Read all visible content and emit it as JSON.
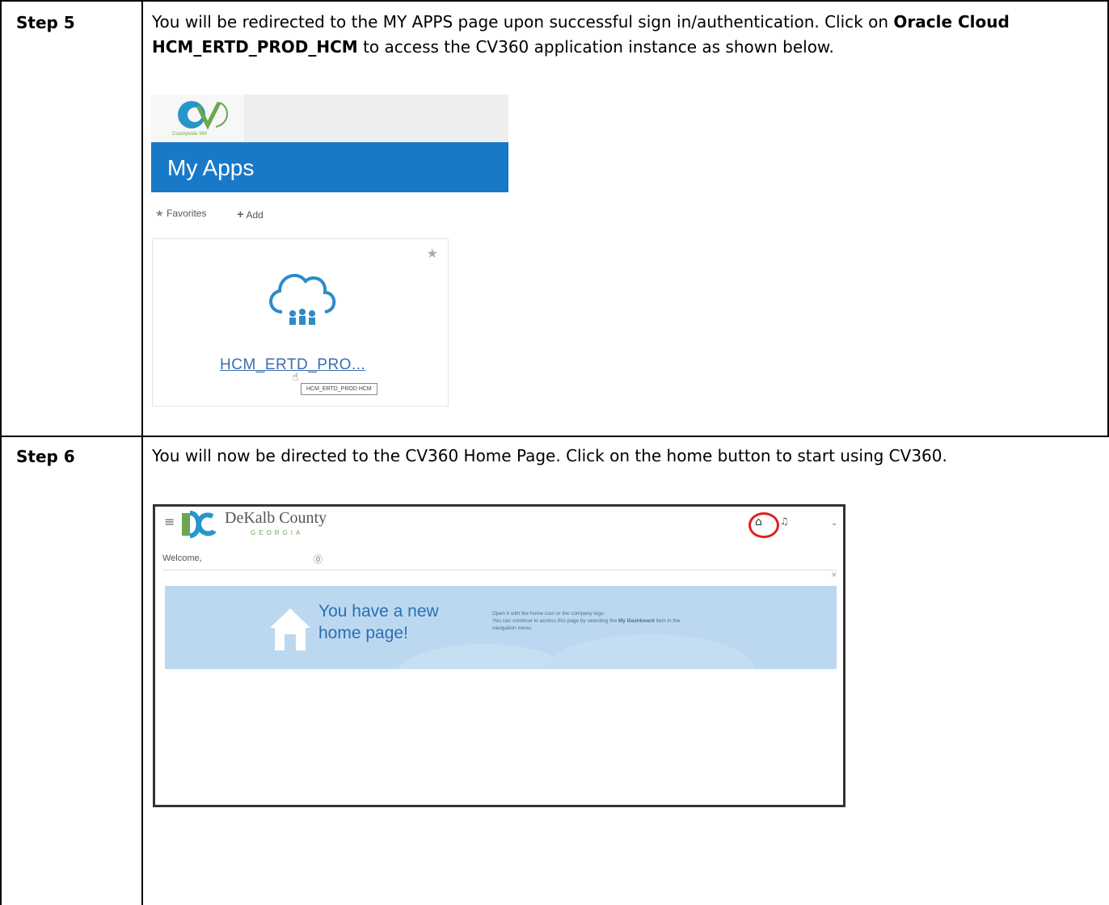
{
  "steps": [
    {
      "label": "Step 5",
      "text_before": "You will be redirected to the MY APPS page upon successful sign in/authentication. Click on",
      "text_bold": "Oracle Cloud HCM_ERTD_PROD_HCM",
      "text_after": "to access the CV360 application instance as shown below."
    },
    {
      "label": "Step 6",
      "text": "You will now be directed to the CV360 Home Page. Click on the home button to start using CV360."
    }
  ],
  "my_apps_screenshot": {
    "logo_subtext": "Countywide 360",
    "title": "My Apps",
    "favorites_label": "Favorites",
    "add_label": "Add",
    "app_tile_label": "HCM_ERTD_PRO...",
    "tooltip": "HCM_ERTD_PROD HCM",
    "icons": [
      "star-icon",
      "plus-icon",
      "cloud-people-icon",
      "cursor-icon"
    ],
    "colors": {
      "header_bar": "#1979c9",
      "link": "#3a6db0"
    }
  },
  "cv360_screenshot": {
    "brand": "DeKalb County",
    "brand_sub": "GEORGIA",
    "welcome": "Welcome,",
    "banner_title": "You have a new home page!",
    "banner_title_line1": "You have a new",
    "banner_title_line2": "home page!",
    "banner_text_line1": "Open it with the home icon or the company logo.",
    "banner_text_line2": "You can continue to access this page by selecting the",
    "banner_text_bold": "My Dashboard",
    "banner_text_line3": "item in the navigation menu.",
    "icons": [
      "menu-icon",
      "home-icon",
      "bell-icon",
      "chevron-down-icon",
      "help-icon",
      "close-icon",
      "house-icon"
    ],
    "colors": {
      "banner": "#bcd8f0",
      "highlight_ring": "#e02020"
    }
  }
}
